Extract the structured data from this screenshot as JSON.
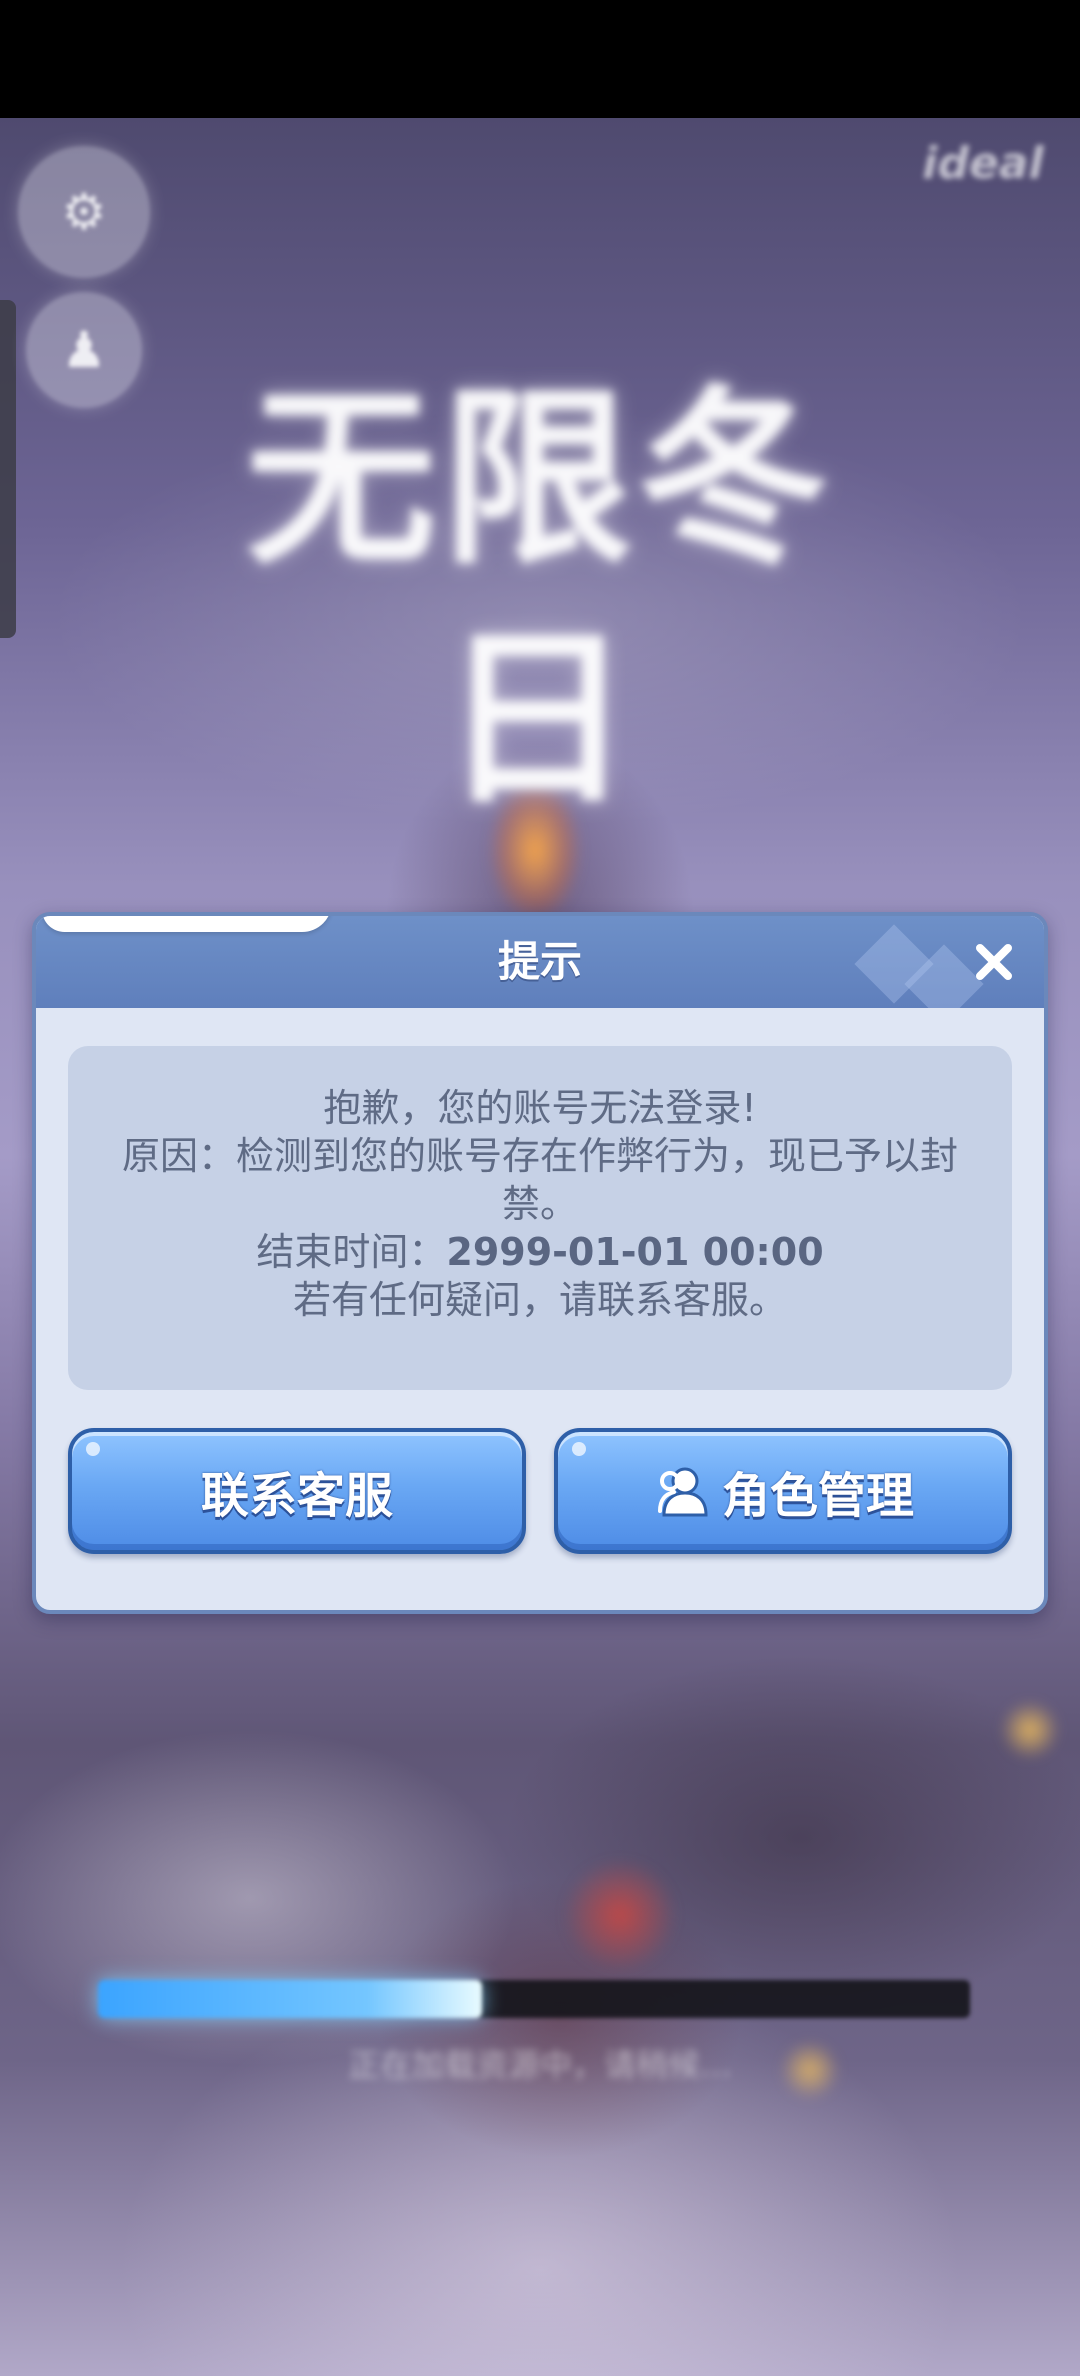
{
  "background": {
    "game_title": "无限冬日",
    "corner_logo": "ideal",
    "loading_progress": 0.44,
    "loading_text": "正在加载资源中，请稍候…"
  },
  "dialog": {
    "title": "提示",
    "message": {
      "line1": "抱歉，您的账号无法登录!",
      "line2": "原因：检测到您的账号存在作弊行为，现已予以封禁。",
      "end_time_label": "结束时间：",
      "end_time_value": "2999-01-01 00:00",
      "line4": "若有任何疑问，请联系客服。"
    },
    "buttons": {
      "contact_label": "联系客服",
      "role_label": "角色管理"
    }
  },
  "icons": {
    "close": "close-icon",
    "role": "user-icon",
    "settings": "gear-icon",
    "account": "person-icon"
  },
  "colors": {
    "dialog_bg": "#dfe6f4",
    "header": "#5f7fbc",
    "button": "#6aa8f4",
    "message_bg": "#c6d1e6",
    "text": "#5f6b85"
  }
}
